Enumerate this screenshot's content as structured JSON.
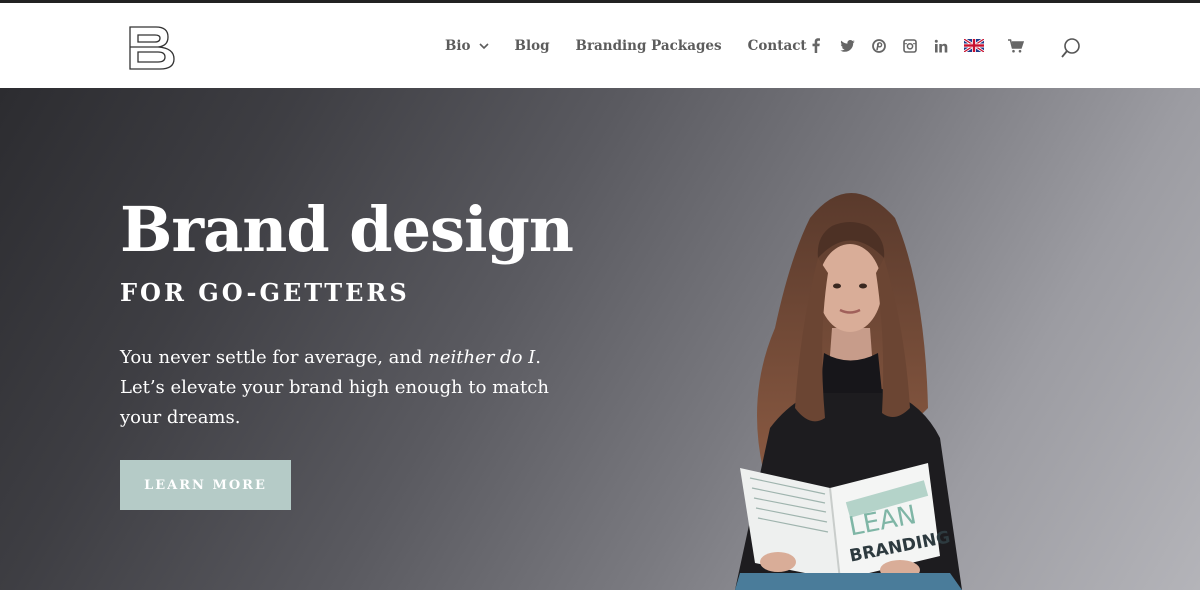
{
  "header": {
    "logo_icon": "letter-b-logo",
    "nav": [
      {
        "label": "Bio",
        "has_dropdown": true
      },
      {
        "label": "Blog"
      },
      {
        "label": "Branding Packages"
      },
      {
        "label": "Contact"
      }
    ],
    "social_icons": [
      "facebook-icon",
      "twitter-icon",
      "pinterest-icon",
      "instagram-icon",
      "linkedin-icon",
      "uk-flag-icon",
      "cart-icon"
    ],
    "search_icon": "search-icon"
  },
  "hero": {
    "title": "Brand design",
    "subtitle": "FOR GO-GETTERS",
    "paragraph_before": "You never settle for average, and ",
    "paragraph_italic": "neither do I",
    "paragraph_after": ". Let’s elevate your brand high enough to match your dreams.",
    "button_label": "LEARN MORE",
    "book_title_line1": "LEAN",
    "book_title_line2": "BRANDING"
  },
  "colors": {
    "button_bg": "#b5cbc7",
    "nav_text": "#5c5c5c",
    "hero_text": "#ffffff"
  }
}
